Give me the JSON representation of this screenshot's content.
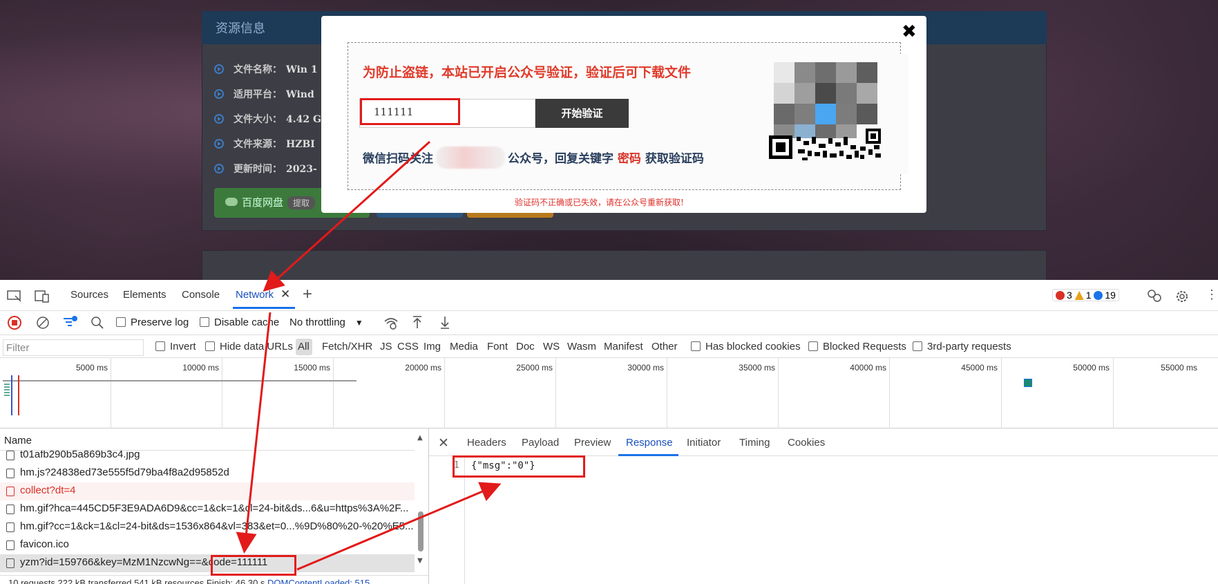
{
  "page": {
    "panel_title": "资源信息",
    "info": [
      {
        "label": "文件名称：",
        "value": "Win 1"
      },
      {
        "label": "适用平台：",
        "value": "Wind"
      },
      {
        "label": "文件大小：",
        "value": "4.42 G"
      },
      {
        "label": "文件来源：",
        "value": "HZBI"
      },
      {
        "label": "更新时间：",
        "value": "2023-"
      }
    ],
    "baidu_button": "百度网盘",
    "baidu_code": "提取"
  },
  "modal": {
    "warning": "为防止盗链，本站已开启公众号验证，验证后可下载文件",
    "code_value": "111111",
    "verify_button": "开始验证",
    "wechat_prefix": "微信扫码关注",
    "wechat_middle": "公众号，回复关键字",
    "keyword": "密码",
    "wechat_suffix": "获取验证码",
    "expire_msg": "验证码不正确或已失效，请在公众号重新获取!"
  },
  "devtools": {
    "tabs": [
      "Sources",
      "Elements",
      "Console",
      "Network"
    ],
    "errors": "3",
    "warnings": "1",
    "messages": "19",
    "toolbar": {
      "preserve_log": "Preserve log",
      "disable_cache": "Disable cache",
      "throttling": "No throttling"
    },
    "filter": {
      "placeholder": "Filter",
      "invert": "Invert",
      "hide_data_urls": "Hide data URLs",
      "all": "All",
      "types": [
        "Fetch/XHR",
        "JS",
        "CSS",
        "Img",
        "Media",
        "Font",
        "Doc",
        "WS",
        "Wasm",
        "Manifest",
        "Other"
      ],
      "has_blocked_cookies": "Has blocked cookies",
      "blocked_requests": "Blocked Requests",
      "third_party": "3rd-party requests"
    },
    "timeline_ticks": [
      "5000 ms",
      "10000 ms",
      "15000 ms",
      "20000 ms",
      "25000 ms",
      "30000 ms",
      "35000 ms",
      "40000 ms",
      "45000 ms",
      "50000 ms",
      "55000 ms"
    ],
    "name_header": "Name",
    "requests": [
      {
        "name": "t01afb290b5a869b3c4.jpg",
        "status": "normal"
      },
      {
        "name": "hm.js?24838ed73e555f5d79ba4f8a2d95852d",
        "status": "normal"
      },
      {
        "name": "collect?dt=4",
        "status": "error"
      },
      {
        "name": "hm.gif?hca=445CD5F3E9ADA6D9&cc=1&ck=1&cl=24-bit&ds...6&u=https%3A%2F...",
        "status": "normal"
      },
      {
        "name": "hm.gif?cc=1&ck=1&cl=24-bit&ds=1536x864&vl=383&et=0...%9D%80%20-%20%E5...",
        "status": "normal"
      },
      {
        "name": "favicon.ico",
        "status": "normal"
      },
      {
        "name": "yzm?id=159766&key=MzM1NzcwNg==&code=111111",
        "status": "selected"
      }
    ],
    "detail_tabs": [
      "Headers",
      "Payload",
      "Preview",
      "Response",
      "Initiator",
      "Timing",
      "Cookies"
    ],
    "response": {
      "line": "1",
      "text": "{\"msg\":\"0\"}"
    },
    "status_bar": {
      "text": "10 requests  222 kB transferred  541 kB resources  Finish: 46.30 s",
      "dcl": "DOMContentLoaded: 515"
    }
  },
  "colors": {
    "accent": "#1a73e8",
    "annotation": "#e21a1a",
    "warning_text": "#e03a2a"
  }
}
